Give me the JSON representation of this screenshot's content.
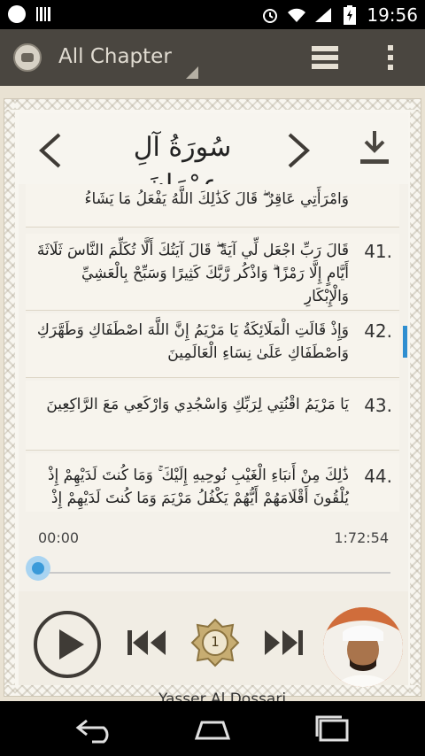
{
  "statusbar": {
    "time": "19:56"
  },
  "actionbar": {
    "title": "All Chapter"
  },
  "nav": {
    "surah_name": "سُورَةُ آلِ عِمْرَانَ"
  },
  "verses": [
    {
      "number": "",
      "text": "وَامْرَأَتِي عَاقِرٌ ۖ قَالَ كَذَٰلِكَ اللَّهُ يَفْعَلُ مَا يَشَاءُ"
    },
    {
      "number": "41.",
      "text": "قَالَ رَبِّ اجْعَل لِّي آيَةً ۖ قَالَ آيَتُكَ أَلَّا تُكَلِّمَ النَّاسَ ثَلَاثَةَ أَيَّامٍ إِلَّا رَمْزًا ۗ وَاذْكُر رَّبَّكَ كَثِيرًا وَسَبِّحْ بِالْعَشِيِّ وَالْإِبْكَارِ"
    },
    {
      "number": "42.",
      "text": "وَإِذْ قَالَتِ الْمَلَائِكَةُ يَا مَرْيَمُ إِنَّ اللَّهَ اصْطَفَاكِ وَطَهَّرَكِ وَاصْطَفَاكِ عَلَىٰ نِسَاءِ الْعَالَمِينَ"
    },
    {
      "number": "43.",
      "text": "يَا مَرْيَمُ اقْنُتِي لِرَبِّكِ وَاسْجُدِي وَارْكَعِي مَعَ الرَّاكِعِينَ"
    },
    {
      "number": "44.",
      "text": "ذَٰلِكَ مِنْ أَنبَاءِ الْغَيْبِ نُوحِيهِ إِلَيْكَ ۚ وَمَا كُنتَ لَدَيْهِمْ إِذْ يُلْقُونَ أَقْلَامَهُمْ أَيُّهُمْ يَكْفُلُ مَرْيَمَ وَمَا كُنتَ لَدَيْهِمْ إِذْ يَخْتَصِمُونَ"
    }
  ],
  "player": {
    "current_time": "00:00",
    "total_time": "1:72:54",
    "progress": 0,
    "repeat_count": "1",
    "reciter": "Yasser Al Dossari"
  },
  "colors": {
    "actionbar": "#4a4640",
    "accent": "#2f8ed0",
    "gold": "#b89a55"
  }
}
